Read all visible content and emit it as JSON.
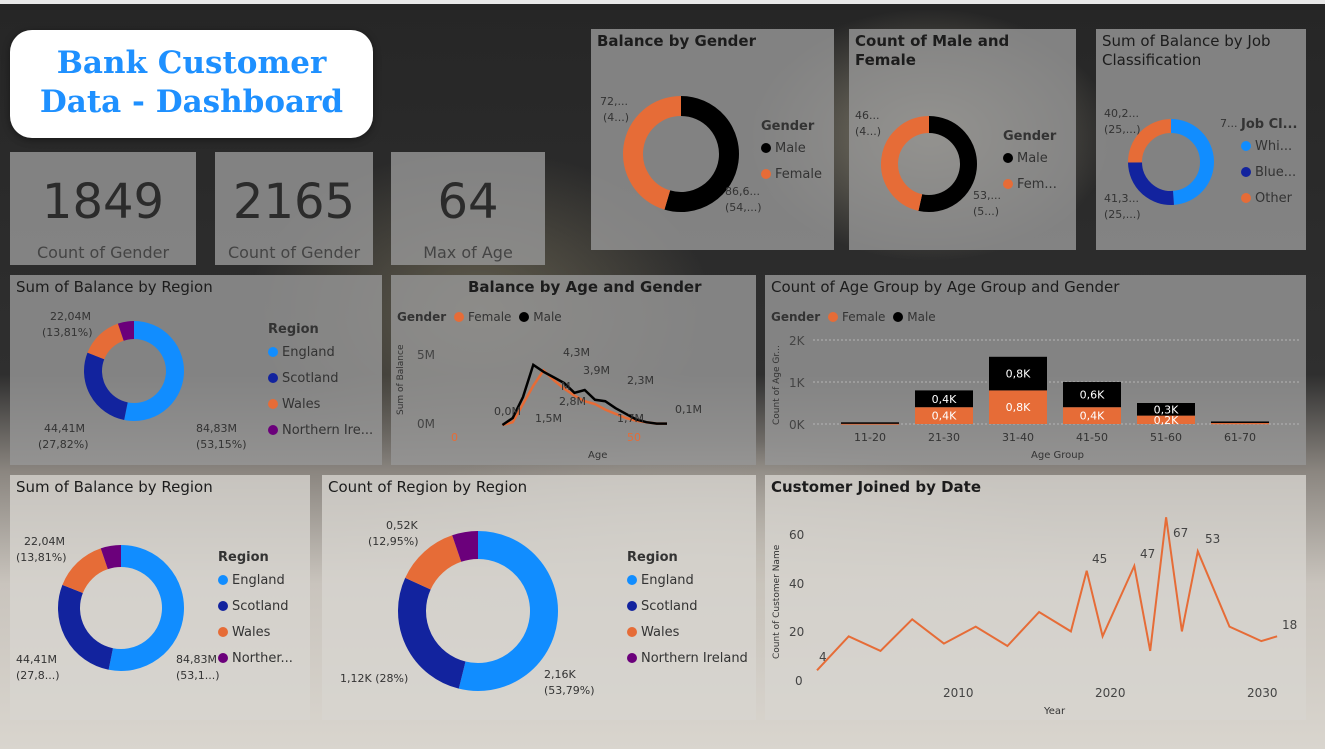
{
  "colors": {
    "england": "#118dff",
    "scotland": "#12239e",
    "wales": "#e66c37",
    "ni": "#6b007b",
    "female": "#e66c37",
    "male": "#000000"
  },
  "title": {
    "line1": "Bank Customer",
    "line2": "Data - Dashboard"
  },
  "kpis": [
    {
      "value": "1849",
      "label": "Count of Gender"
    },
    {
      "value": "2165",
      "label": "Count of Gender"
    },
    {
      "value": "64",
      "label": "Max of Age"
    }
  ],
  "balance_gender": {
    "title": "Balance by Gender",
    "legend_title": "Gender",
    "legend": [
      "Male",
      "Female"
    ],
    "labels": {
      "female": "72,...",
      "female_pct": "(4...)",
      "male": "86,6...",
      "male_pct": "(54,...)"
    }
  },
  "count_gender": {
    "title": "Count of Male and Female",
    "legend_title": "Gender",
    "legend": [
      "Male",
      "Fem..."
    ],
    "labels": {
      "female": "46...",
      "female_pct": "(4...)",
      "male": "53,...",
      "male_pct": "(5...)"
    }
  },
  "job_class": {
    "title": "Sum of Balance by Job Classification",
    "legend_title": "Job Cl...",
    "legend": [
      "Whi...",
      "Blue...",
      "Other"
    ],
    "labels": {
      "a": "7...",
      "b": "40,2...",
      "b_pct": "(25,...)",
      "c": "41,3...",
      "c_pct": "(25,...)"
    }
  },
  "region1": {
    "title": "Sum of Balance by Region",
    "legend_title": "Region",
    "legend": [
      "England",
      "Scotland",
      "Wales",
      "Northern Ire..."
    ],
    "labels": {
      "wales": "22,04M",
      "wales_pct": "(13,81%)",
      "scot": "44,41M",
      "scot_pct": "(27,82%)",
      "eng": "84,83M",
      "eng_pct": "(53,15%)"
    }
  },
  "age_gender": {
    "title": "Balance by Age and Gender",
    "legend_title": "Gender",
    "legend": [
      "Female",
      "Male"
    ],
    "ylabel": "Sum of Balance",
    "xlabel": "Age",
    "yticks": [
      "5M",
      "0M"
    ],
    "xticks": [
      "0",
      "50"
    ],
    "annotations": [
      "4,3M",
      "3,9M",
      "2,8M",
      "2,3M",
      "0,0M",
      "1,5M",
      "1,7M",
      "0,1M",
      "M"
    ]
  },
  "age_group": {
    "title": "Count of Age Group by Age Group and Gender",
    "legend_title": "Gender",
    "legend": [
      "Female",
      "Male"
    ],
    "ylabel": "Count of Age Gr...",
    "xlabel": "Age Group",
    "yticks": [
      "2K",
      "1K",
      "0K"
    ]
  },
  "region2": {
    "title": "Sum of Balance by Region",
    "legend_title": "Region",
    "legend": [
      "England",
      "Scotland",
      "Wales",
      "Norther..."
    ],
    "labels": {
      "wales": "22,04M",
      "wales_pct": "(13,81%)",
      "scot": "44,41M",
      "scot_pct": "(27,8...)",
      "eng": "84,83M",
      "eng_pct": "(53,1...)"
    }
  },
  "region_count": {
    "title": "Count of Region by Region",
    "legend_title": "Region",
    "legend": [
      "England",
      "Scotland",
      "Wales",
      "Northern Ireland"
    ],
    "labels": {
      "wales": "0,52K",
      "wales_pct": "(12,95%)",
      "scot": "1,12K (28%)",
      "eng": "2,16K",
      "eng_pct": "(53,79%)"
    }
  },
  "joined": {
    "title": "Customer Joined by Date",
    "ylabel": "Count of Customer Name",
    "xlabel": "Year",
    "yticks": [
      "60",
      "40",
      "20",
      "0"
    ],
    "xticks": [
      "2010",
      "2020",
      "2030"
    ],
    "peaks": [
      "45",
      "47",
      "67",
      "53",
      "18",
      "4"
    ]
  },
  "chart_data": [
    {
      "type": "pie",
      "title": "Balance by Gender",
      "categories": [
        "Male",
        "Female"
      ],
      "values": [
        86.6,
        72.0
      ]
    },
    {
      "type": "pie",
      "title": "Count of Male and Female",
      "categories": [
        "Male",
        "Female"
      ],
      "values": [
        53,
        46
      ]
    },
    {
      "type": "pie",
      "title": "Sum of Balance by Job Classification",
      "categories": [
        "White Collar",
        "Blue Collar",
        "Other"
      ],
      "values": [
        78,
        41.3,
        40.2
      ]
    },
    {
      "type": "pie",
      "title": "Sum of Balance by Region",
      "categories": [
        "England",
        "Scotland",
        "Wales",
        "Northern Ireland"
      ],
      "values": [
        84.83,
        44.41,
        22.04,
        8.32
      ]
    },
    {
      "type": "line",
      "title": "Balance by Age and Gender",
      "xlabel": "Age",
      "ylabel": "Sum of Balance",
      "x": [
        15,
        18,
        21,
        24,
        27,
        30,
        33,
        36,
        39,
        42,
        45,
        48,
        51,
        54,
        57,
        60,
        63
      ],
      "series": [
        {
          "name": "Female",
          "values": [
            0.0,
            0.2,
            1.5,
            2.8,
            3.9,
            3.2,
            2.6,
            2.1,
            1.7,
            1.5,
            1.1,
            0.8,
            0.5,
            0.3,
            0.2,
            0.1,
            0.1
          ]
        },
        {
          "name": "Male",
          "values": [
            0.0,
            0.5,
            2.0,
            4.3,
            3.8,
            3.4,
            3.0,
            2.3,
            2.5,
            1.8,
            1.7,
            1.2,
            0.8,
            0.4,
            0.2,
            0.1,
            0.1
          ]
        }
      ]
    },
    {
      "type": "bar",
      "title": "Count of Age Group by Age Group and Gender",
      "xlabel": "Age Group",
      "categories": [
        "11-20",
        "21-30",
        "31-40",
        "41-50",
        "51-60",
        "61-70"
      ],
      "series": [
        {
          "name": "Female",
          "values": [
            0.02,
            0.4,
            0.8,
            0.4,
            0.2,
            0.03
          ]
        },
        {
          "name": "Male",
          "values": [
            0.02,
            0.4,
            0.8,
            0.6,
            0.3,
            0.03
          ]
        }
      ]
    },
    {
      "type": "pie",
      "title": "Sum of Balance by Region",
      "categories": [
        "England",
        "Scotland",
        "Wales",
        "Northern Ireland"
      ],
      "values": [
        84.83,
        44.41,
        22.04,
        8.32
      ]
    },
    {
      "type": "pie",
      "title": "Count of Region by Region",
      "categories": [
        "England",
        "Scotland",
        "Wales",
        "Northern Ireland"
      ],
      "values": [
        2.16,
        1.12,
        0.52,
        0.21
      ]
    },
    {
      "type": "line",
      "title": "Customer Joined by Date",
      "xlabel": "Year",
      "ylabel": "Count of Customer Name",
      "x": [
        2002,
        2004,
        2006,
        2008,
        2010,
        2012,
        2014,
        2016,
        2018,
        2019,
        2020,
        2022,
        2023,
        2024,
        2025,
        2026,
        2028,
        2030,
        2031
      ],
      "series": [
        {
          "name": "",
          "values": [
            4,
            18,
            12,
            25,
            15,
            22,
            14,
            28,
            20,
            45,
            18,
            47,
            12,
            67,
            20,
            53,
            22,
            16,
            18
          ]
        }
      ]
    }
  ]
}
